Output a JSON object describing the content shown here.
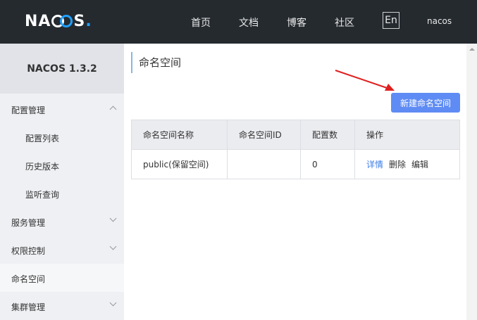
{
  "header": {
    "logo": {
      "n": "N",
      "a": "A",
      "s": "S",
      "dot": "."
    },
    "nav": [
      "首页",
      "文档",
      "博客",
      "社区"
    ],
    "lang": "En",
    "user": "nacos"
  },
  "sidebar": {
    "version": "NACOS 1.3.2",
    "items": [
      {
        "label": "配置管理",
        "chevron": "up"
      },
      {
        "label": "配置列表"
      },
      {
        "label": "历史版本"
      },
      {
        "label": "监听查询"
      },
      {
        "label": "服务管理",
        "chevron": "down"
      },
      {
        "label": "权限控制",
        "chevron": "down"
      },
      {
        "label": "命名空间",
        "active": true
      },
      {
        "label": "集群管理",
        "chevron": "down"
      }
    ]
  },
  "main": {
    "title": "命名空间",
    "create_button": "新建命名空间",
    "table": {
      "headers": [
        "命名空间名称",
        "命名空间ID",
        "配置数",
        "操作"
      ],
      "rows": [
        {
          "name": "public(保留空间)",
          "id": "",
          "count": "0",
          "ops": [
            "详情",
            "删除",
            "编辑"
          ]
        }
      ]
    }
  },
  "colors": {
    "topbar": "#252a2f",
    "accent": "#20a0ff",
    "primary_button": "#5f8cf4",
    "link": "#3c7ce8",
    "arrow": "#e02020"
  }
}
